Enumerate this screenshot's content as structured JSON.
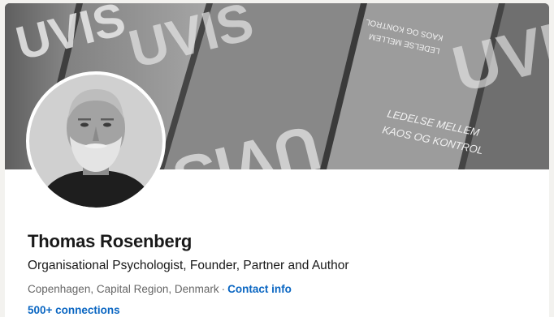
{
  "banner": {
    "book_title_large": "UVIS",
    "book_subtitle_line1": "LEDELSE MELLEM",
    "book_subtitle_line2": "KAOS OG KONTROL"
  },
  "profile": {
    "name": "Thomas Rosenberg",
    "headline": "Organisational Psychologist, Founder, Partner and Author",
    "location": "Copenhagen, Capital Region, Denmark",
    "separator": "·",
    "contact_info_label": "Contact info",
    "connections_label": "500+ connections"
  }
}
